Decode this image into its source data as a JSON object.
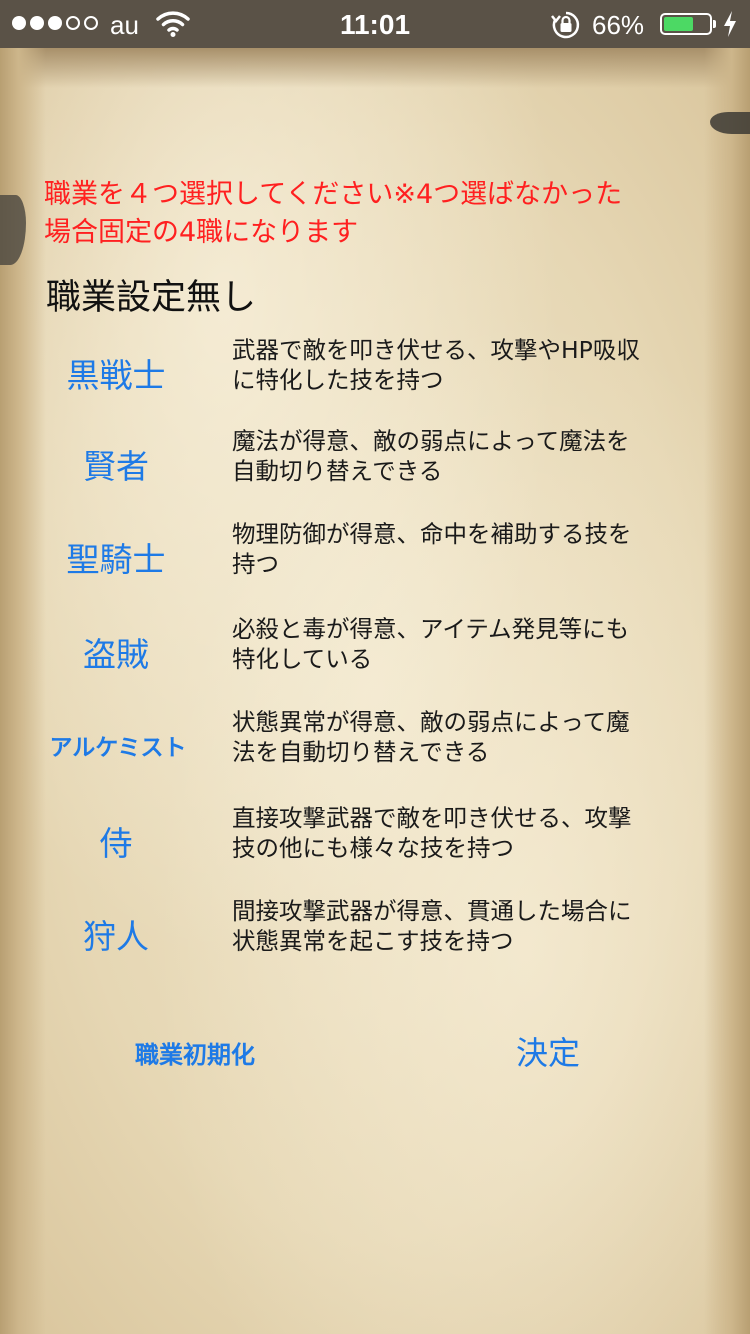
{
  "status_bar": {
    "carrier": "au",
    "time": "11:01",
    "battery_percent": "66%",
    "battery_level": 0.66,
    "signal_bars_filled": 3,
    "signal_bars_total": 5
  },
  "notice": {
    "line1": "職業を４つ選択してください※4つ選ばなかった",
    "line2": "場合固定の4職になります"
  },
  "current_job_label": "職業設定無し",
  "jobs": [
    {
      "name": "黒戦士",
      "desc1": "武器で敵を叩き伏せる、攻撃やHP吸収",
      "desc2": "に特化した技を持つ"
    },
    {
      "name": "賢者",
      "desc1": "魔法が得意、敵の弱点によって魔法を",
      "desc2": "自動切り替えできる"
    },
    {
      "name": "聖騎士",
      "desc1": "物理防御が得意、命中を補助する技を",
      "desc2": "持つ"
    },
    {
      "name": "盗賊",
      "desc1": "必殺と毒が得意、アイテム発見等にも",
      "desc2": "特化している"
    },
    {
      "name": "アルケミスト",
      "desc1": "状態異常が得意、敵の弱点によって魔",
      "desc2": "法を自動切り替えできる"
    },
    {
      "name": "侍",
      "desc1": "直接攻撃武器で敵を叩き伏せる、攻撃",
      "desc2": "技の他にも様々な技を持つ"
    },
    {
      "name": "狩人",
      "desc1": "間接攻撃武器が得意、貫通した場合に",
      "desc2": "状態異常を起こす技を持つ"
    }
  ],
  "buttons": {
    "reset": "職業初期化",
    "confirm": "決定"
  },
  "colors": {
    "accent": "#1e7ae6",
    "notice": "#ff2020",
    "status_bar": "#5a5247",
    "battery": "#4cd964"
  },
  "icons": [
    "wifi-icon",
    "rotation-lock-icon",
    "battery-icon",
    "charging-icon"
  ]
}
